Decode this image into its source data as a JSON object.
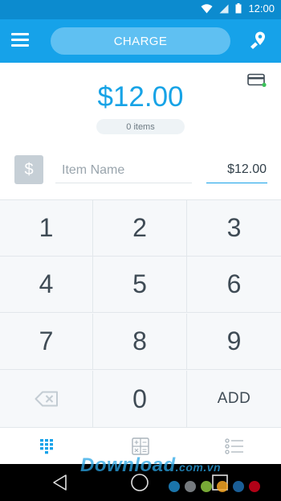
{
  "status_bar": {
    "time": "12:00"
  },
  "app_bar": {
    "charge_label": "CHARGE"
  },
  "sale": {
    "total": "$12.00",
    "items_count": "0 items"
  },
  "item_entry": {
    "currency_symbol": "$",
    "name_placeholder": "Item Name",
    "price": "$12.00"
  },
  "keypad": {
    "keys": [
      "1",
      "2",
      "3",
      "4",
      "5",
      "6",
      "7",
      "8",
      "9",
      "0"
    ],
    "add_label": "ADD"
  },
  "bottom_tabs": [
    {
      "icon": "keypad-icon",
      "active": true
    },
    {
      "icon": "calculator-icon",
      "active": false
    },
    {
      "icon": "list-icon",
      "active": false
    }
  ],
  "watermark": {
    "text": "Download",
    "suffix": ".com.vn"
  },
  "colors": {
    "primary": "#16a2e9",
    "status_bar": "#0c8bcf",
    "charge_button": "#5fc0f2",
    "total_text": "#17a3e6",
    "watermark_dots": [
      "#1e88c8",
      "#8a8f94",
      "#8cc63f",
      "#f5a623",
      "#1e6fb0",
      "#d0021b"
    ]
  }
}
